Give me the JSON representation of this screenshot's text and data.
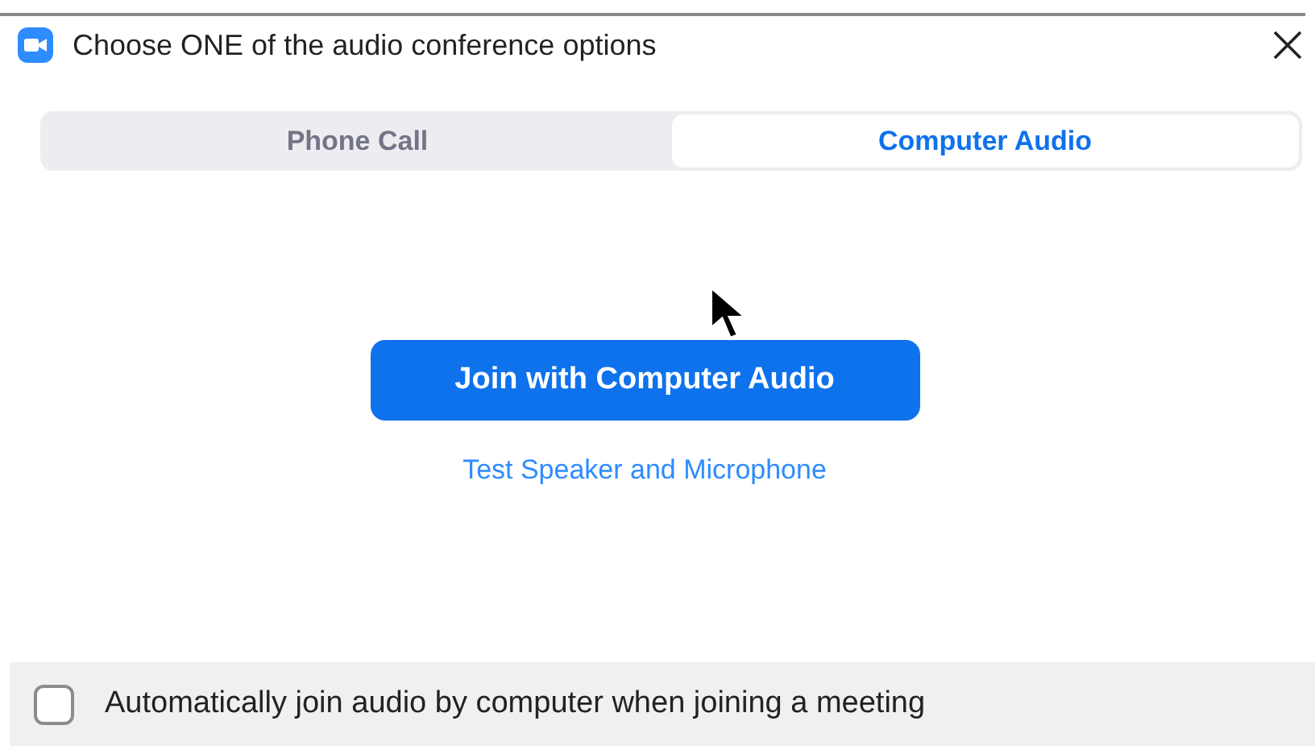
{
  "window": {
    "title": "Choose ONE of the audio conference options"
  },
  "tabs": [
    {
      "label": "Phone Call",
      "selected": false
    },
    {
      "label": "Computer Audio",
      "selected": true
    }
  ],
  "join_button": {
    "label": "Join with Computer Audio"
  },
  "test_link": {
    "label": "Test Speaker and Microphone"
  },
  "auto_join": {
    "label": "Automatically join audio by computer when joining a meeting",
    "checked": false
  }
}
